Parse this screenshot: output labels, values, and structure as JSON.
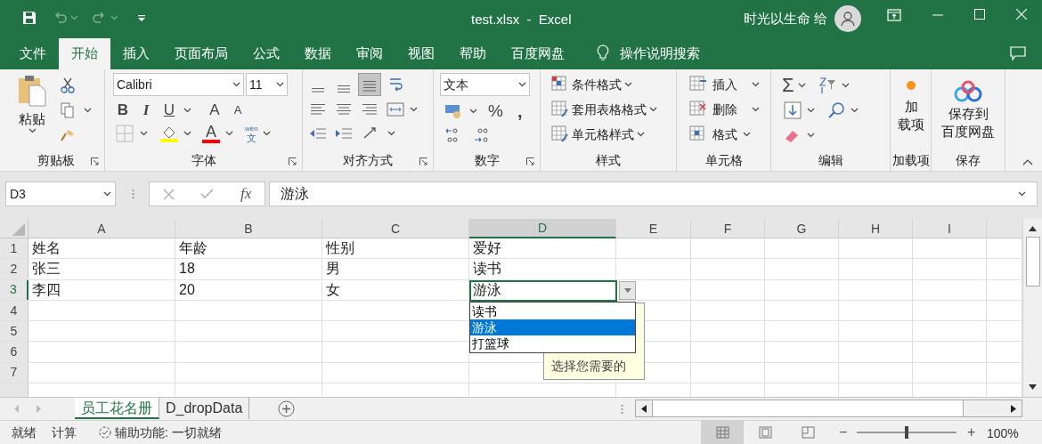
{
  "window": {
    "title": "test.xlsx  -  Excel",
    "user": "时光以生命 给"
  },
  "menu_tabs": [
    {
      "label": "文件",
      "selected": false
    },
    {
      "label": "开始",
      "selected": true
    },
    {
      "label": "插入",
      "selected": false
    },
    {
      "label": "页面布局",
      "selected": false
    },
    {
      "label": "公式",
      "selected": false
    },
    {
      "label": "数据",
      "selected": false
    },
    {
      "label": "审阅",
      "selected": false
    },
    {
      "label": "视图",
      "selected": false
    },
    {
      "label": "帮助",
      "selected": false
    },
    {
      "label": "百度网盘",
      "selected": false
    }
  ],
  "tell_me": "操作说明搜索",
  "ribbon": {
    "clipboard": {
      "paste": "粘贴",
      "label": "剪贴板"
    },
    "font": {
      "name": "Calibri",
      "size": "11",
      "bold": "B",
      "italic": "I",
      "underline": "U",
      "grow": "A",
      "shrink": "A",
      "font_color": "A",
      "phonetic": "wén",
      "phonetic_char": "文",
      "label": "字体"
    },
    "alignment": {
      "vertical": [
        {
          "selected": false
        },
        {
          "selected": false
        },
        {
          "selected": true
        }
      ],
      "label": "对齐方式"
    },
    "number": {
      "format": "文本",
      "percent": "%",
      "comma": ",",
      "label": "数字"
    },
    "styles": {
      "items": [
        "条件格式",
        "套用表格格式",
        "单元格样式"
      ],
      "label": "样式"
    },
    "cells": {
      "items": [
        "插入",
        "删除",
        "格式"
      ],
      "label": "单元格"
    },
    "editing": {
      "sum": "Σ",
      "label": "编辑"
    },
    "addins": {
      "lines": [
        "加",
        "载项"
      ],
      "label": "加载项"
    },
    "save": {
      "lines": [
        "保存到",
        "百度网盘"
      ],
      "label": "保存"
    }
  },
  "formula_bar": {
    "name_box": "D3",
    "fx": "fx",
    "value": "游泳"
  },
  "sheet": {
    "columns": [
      {
        "label": "A",
        "selected": false
      },
      {
        "label": "B",
        "selected": false
      },
      {
        "label": "C",
        "selected": false
      },
      {
        "label": "D",
        "selected": true
      },
      {
        "label": "E",
        "selected": false
      },
      {
        "label": "F",
        "selected": false
      },
      {
        "label": "G",
        "selected": false
      },
      {
        "label": "H",
        "selected": false
      },
      {
        "label": "I",
        "selected": false
      }
    ],
    "rows": [
      {
        "header": "1",
        "selected": false,
        "cells": [
          "姓名",
          "年龄",
          "性别",
          "爱好"
        ]
      },
      {
        "header": "2",
        "selected": false,
        "cells": [
          "张三",
          "18",
          "男",
          "读书"
        ]
      },
      {
        "header": "3",
        "selected": true,
        "cells": [
          "李四",
          "20",
          "女",
          "游泳"
        ]
      },
      {
        "header": "4",
        "selected": false,
        "cells": []
      },
      {
        "header": "5",
        "selected": false,
        "cells": []
      },
      {
        "header": "6",
        "selected": false,
        "cells": []
      },
      {
        "header": "7",
        "selected": false,
        "cells": []
      }
    ],
    "dropdown": {
      "options": [
        {
          "label": "读书",
          "selected": false
        },
        {
          "label": "游泳",
          "selected": true
        },
        {
          "label": "打篮球",
          "selected": false
        }
      ]
    },
    "input_message": "选择您需要的"
  },
  "sheet_tabs": [
    {
      "label": "员工花名册",
      "selected": true
    },
    {
      "label": "D_dropData",
      "selected": false
    }
  ],
  "status_bar": {
    "mode": "就绪",
    "calculate": "计算",
    "accessibility": "辅助功能: 一切就绪",
    "views": [
      {
        "selected": true
      },
      {
        "selected": false
      },
      {
        "selected": false
      }
    ],
    "zoom": {
      "out": "−",
      "in": "+",
      "level": 0.5,
      "reading": "100%"
    }
  }
}
